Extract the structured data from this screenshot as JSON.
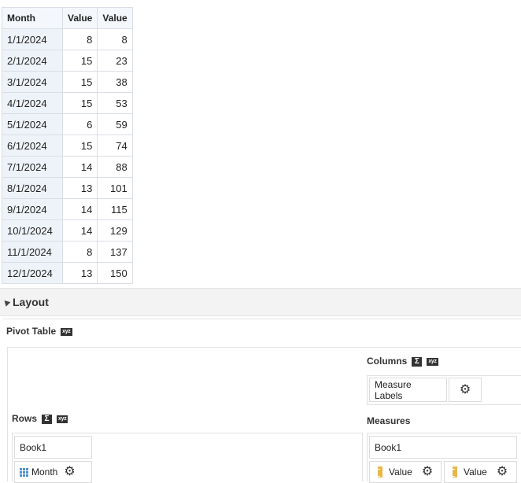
{
  "table": {
    "headers": [
      "Month",
      "Value",
      "Value"
    ],
    "rows": [
      [
        "1/1/2024",
        "8",
        "8"
      ],
      [
        "2/1/2024",
        "15",
        "23"
      ],
      [
        "3/1/2024",
        "15",
        "38"
      ],
      [
        "4/1/2024",
        "15",
        "53"
      ],
      [
        "5/1/2024",
        "6",
        "59"
      ],
      [
        "6/1/2024",
        "15",
        "74"
      ],
      [
        "7/1/2024",
        "14",
        "88"
      ],
      [
        "8/1/2024",
        "13",
        "101"
      ],
      [
        "9/1/2024",
        "14",
        "115"
      ],
      [
        "10/1/2024",
        "14",
        "129"
      ],
      [
        "11/1/2024",
        "8",
        "137"
      ],
      [
        "12/1/2024",
        "13",
        "150"
      ]
    ]
  },
  "layout": {
    "title": "Layout",
    "pivot_label": "Pivot Table",
    "xyz": "xyz",
    "sigma": "Σ",
    "columns": {
      "label": "Columns",
      "chip": "Measure Labels"
    },
    "rows": {
      "label": "Rows",
      "source": "Book1",
      "chip": "Month"
    },
    "measures": {
      "label": "Measures",
      "source": "Book1",
      "chip1": "Value",
      "chip2": "Value"
    },
    "gear": "⚙"
  },
  "colors": {
    "accent": "#4c8dc9",
    "measure_icon": "#e8b64a"
  }
}
